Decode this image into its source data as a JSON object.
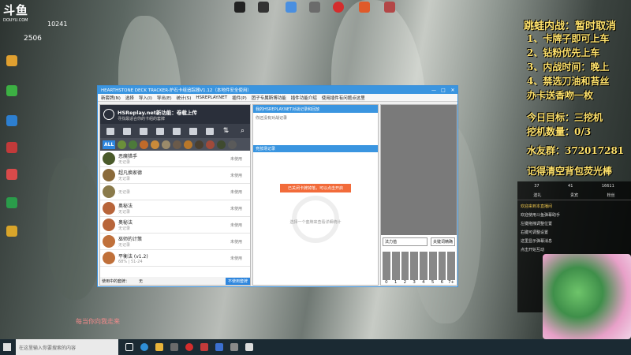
{
  "stream": {
    "logo": "斗鱼",
    "logo_sub": "DOUYU.COM",
    "room_id_top": "10241",
    "room_id": "2506",
    "subtitle": "每当你向我走来"
  },
  "desktop_icons_top": [
    "",
    "",
    "",
    "",
    "",
    "",
    ""
  ],
  "desktop_icons_left": [
    "",
    "",
    "",
    "",
    "",
    "",
    ""
  ],
  "window": {
    "title": "HEARTHSTONE DECK TRACKER-炉石卡组追踪器V1.12（本地件安全使用）",
    "menu": [
      "新套牌(N)",
      "选择",
      "导入(I)",
      "导出(E)",
      "统计(S)",
      "HSREPLAY.NET",
      "插件(P)",
      "团子专属斯博功能",
      "插件功能介绍",
      "使用插件有问题点这里"
    ],
    "hs_banner": {
      "title": "HSReplay.net新功能：卷载上传",
      "sub": "寻找最适合你的卡组的套牌"
    },
    "filters": [
      "",
      "",
      "",
      "",
      "",
      "",
      "",
      "",
      ""
    ],
    "all_label": "ALL",
    "decks": [
      {
        "name": "恶魔猎手",
        "sub": "无记录",
        "status": "未使用"
      },
      {
        "name": "超凡换家德",
        "sub": "无记录",
        "status": "未使用"
      },
      {
        "name": "",
        "sub": "无记录",
        "status": "未使用"
      },
      {
        "name": "奥秘法",
        "sub": "无记录",
        "status": "未使用"
      },
      {
        "name": "奥秘法",
        "sub": "无记录",
        "status": "未使用"
      },
      {
        "name": "巫师的计策",
        "sub": "无记录",
        "status": "未使用"
      },
      {
        "name": "平衡法 (v1.2)",
        "sub": "68% | 51-24",
        "status": "未使用"
      }
    ],
    "footer_label": "使用中的套牌：",
    "footer_value": "无",
    "footer_button": "不使用套牌",
    "mid_head": "我的HSREPLAY.NET对战记录和回放",
    "mid_note": "你还没有对战记录",
    "mid_head2": "竞技场记录",
    "mid_center_btn": "已关闭卡牌掉落，可以点击开启",
    "mid_center_note": "选择一个套牌来查看详细统计",
    "right_select": "法力值",
    "right_button": "关键词精确",
    "mana_labels": [
      "0",
      "1",
      "2",
      "3",
      "4",
      "5",
      "6",
      "7+"
    ]
  },
  "overlay": {
    "rules": [
      "跳蛙内战：暂时取消",
      "1、卡牌子即可上车",
      "2、钻粉优先上车",
      "3、内战时间：晚上",
      "4、禁选刀油和苔丝",
      "办卡送香吻一枚"
    ],
    "goal_label": "今日目标：三挖机",
    "goal_count": "挖机数量：0/3",
    "fan_group": "水友群：372017281",
    "reminder": "记得清空背包荧光棒"
  },
  "chat": {
    "tabs": [
      "送礼",
      "贵宾",
      "粉丝"
    ],
    "stats": [
      "37",
      "41",
      "16611"
    ],
    "lines": [
      "欢迎来到本直播间",
      "欢迎使用斗鱼弹幕助手",
      "左键拖拽调整位置",
      "右键可调整设置",
      "这里显示弹幕消息",
      "点击开始互动"
    ]
  },
  "taskbar": {
    "search_placeholder": "在这里输入你要搜索的内容"
  }
}
